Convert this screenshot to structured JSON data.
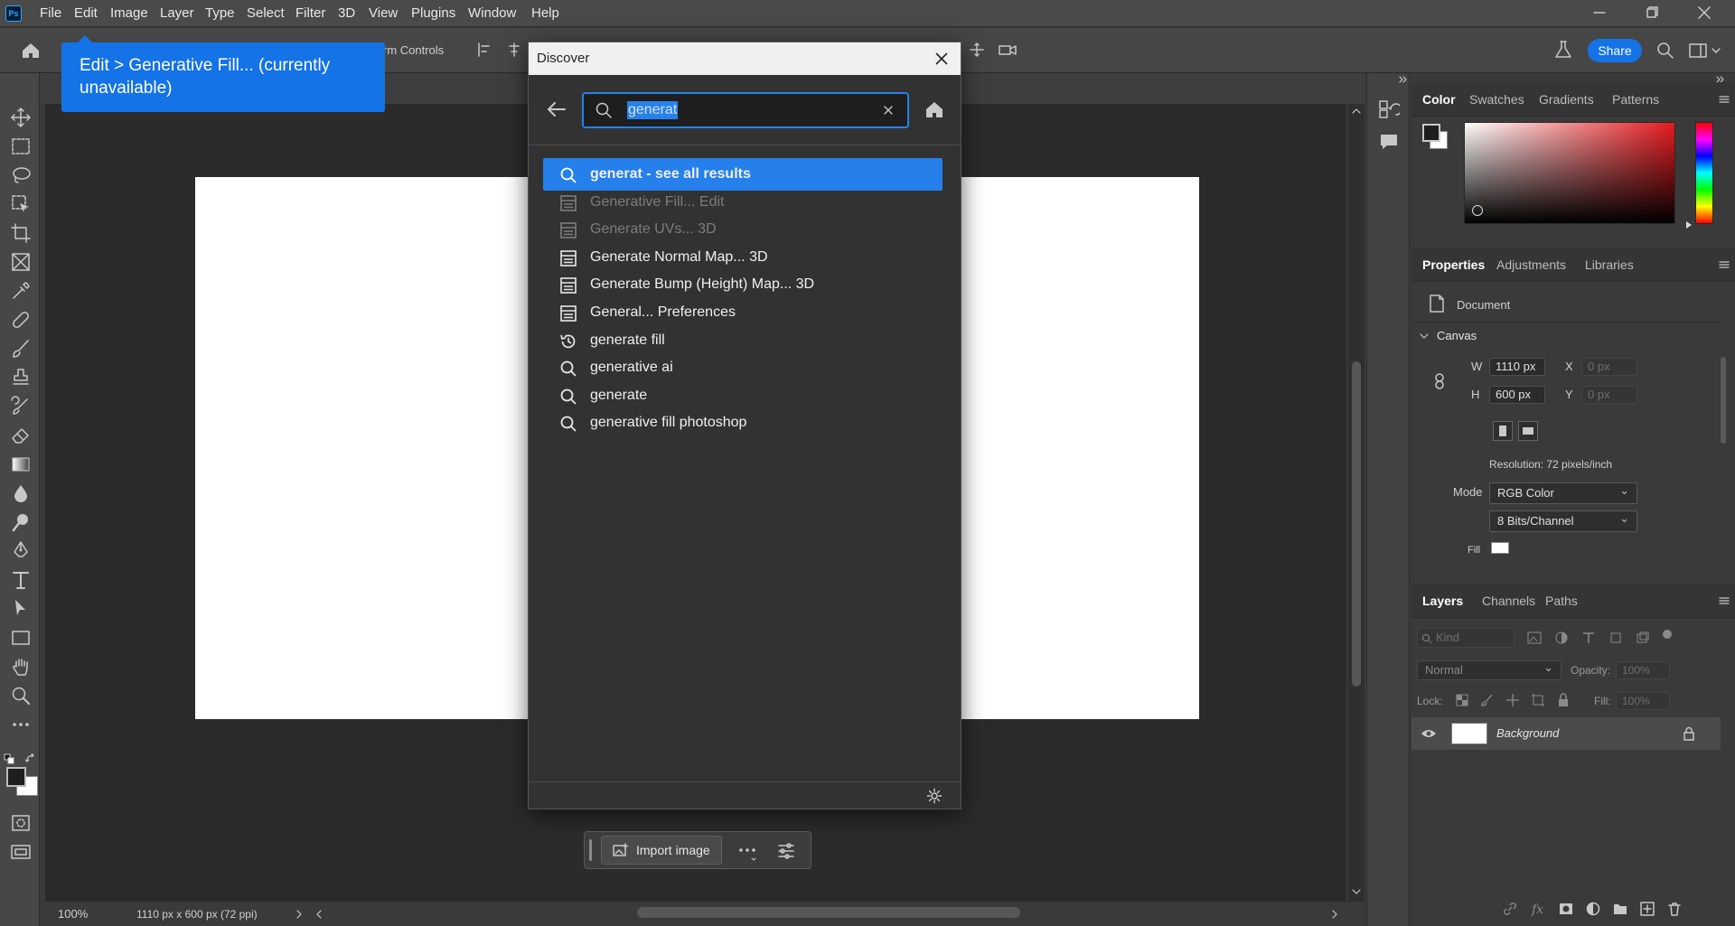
{
  "app": {
    "logo": "Ps",
    "menus": [
      "File",
      "Edit",
      "Image",
      "Layer",
      "Type",
      "Select",
      "Filter",
      "3D",
      "View",
      "Plugins",
      "Window",
      "Help"
    ]
  },
  "options": {
    "transform_controls": "rm Controls",
    "share_label": "Share"
  },
  "tooltip": {
    "text": "Edit > Generative Fill... (currently unavailable)"
  },
  "discover": {
    "title": "Discover",
    "search_value": "generat",
    "results": [
      {
        "label": "generat - see all results",
        "icon": "search-icon",
        "highlighted": true,
        "dim": false
      },
      {
        "label": "Generative Fill... Edit",
        "icon": "menu-icon",
        "dim": true
      },
      {
        "label": "Generate UVs... 3D",
        "icon": "menu-icon",
        "dim": true
      },
      {
        "label": "Generate Normal Map... 3D",
        "icon": "menu-icon",
        "dim": false
      },
      {
        "label": "Generate Bump (Height) Map... 3D",
        "icon": "menu-icon",
        "dim": false
      },
      {
        "label": "General... Preferences",
        "icon": "menu-icon",
        "dim": false
      },
      {
        "label": "generate fill",
        "icon": "history-icon",
        "dim": false
      },
      {
        "label": "generative ai",
        "icon": "search-icon",
        "dim": false
      },
      {
        "label": "generate",
        "icon": "search-icon",
        "dim": false
      },
      {
        "label": "generative fill photoshop",
        "icon": "search-icon",
        "dim": false
      }
    ]
  },
  "contextbar": {
    "import_label": "Import image"
  },
  "status": {
    "zoom": "100%",
    "doc_info": "1110 px x 600 px (72 ppi)"
  },
  "color_panel": {
    "tabs": [
      "Color",
      "Swatches",
      "Gradients",
      "Patterns"
    ],
    "active": "Color",
    "foreground": "#1e1e1e",
    "background": "#ffffff"
  },
  "properties_panel": {
    "tabs": [
      "Properties",
      "Adjustments",
      "Libraries"
    ],
    "doc_label": "Document",
    "canvas_label": "Canvas",
    "w_label": "W",
    "w_value": "1110 px",
    "h_label": "H",
    "h_value": "600 px",
    "x_label": "X",
    "x_value": "0 px",
    "y_label": "Y",
    "y_value": "0 px",
    "resolution": "Resolution: 72 pixels/inch",
    "mode_label": "Mode",
    "mode_value": "RGB Color",
    "depth_value": "8 Bits/Channel",
    "fill_label": "Fill"
  },
  "layers_panel": {
    "tabs": [
      "Layers",
      "Channels",
      "Paths"
    ],
    "kind_placeholder": "Kind",
    "blend_mode": "Normal",
    "opacity_label": "Opacity:",
    "opacity_value": "100%",
    "lock_label": "Lock:",
    "fill_label": "Fill:",
    "fill_value": "100%",
    "layers": [
      {
        "name": "Background",
        "visible": true,
        "locked": true
      }
    ]
  }
}
